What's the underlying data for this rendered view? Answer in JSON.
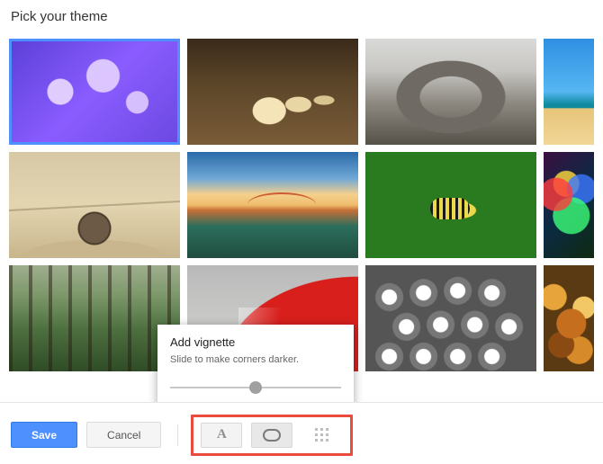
{
  "header": {
    "title": "Pick your theme"
  },
  "popover": {
    "title": "Add vignette",
    "description": "Slide to make corners darker.",
    "slider_value": 50
  },
  "footer": {
    "save_label": "Save",
    "cancel_label": "Cancel"
  },
  "tools": {
    "text_bg_label": "A",
    "vignette_label": "vignette",
    "blur_label": "blur"
  },
  "themes": [
    {
      "name": "jellyfish",
      "selected": true
    },
    {
      "name": "chess-pieces",
      "selected": false
    },
    {
      "name": "rock-arch",
      "selected": false
    },
    {
      "name": "beach",
      "selected": false,
      "partial": true
    },
    {
      "name": "desert-rock",
      "selected": false
    },
    {
      "name": "golden-gate-bridge",
      "selected": false
    },
    {
      "name": "caterpillar",
      "selected": false
    },
    {
      "name": "bokeh-lights",
      "selected": false,
      "partial": true
    },
    {
      "name": "forest",
      "selected": false
    },
    {
      "name": "red-car",
      "selected": false
    },
    {
      "name": "steel-tubes",
      "selected": false
    },
    {
      "name": "autumn-leaves",
      "selected": false,
      "partial": true
    }
  ]
}
